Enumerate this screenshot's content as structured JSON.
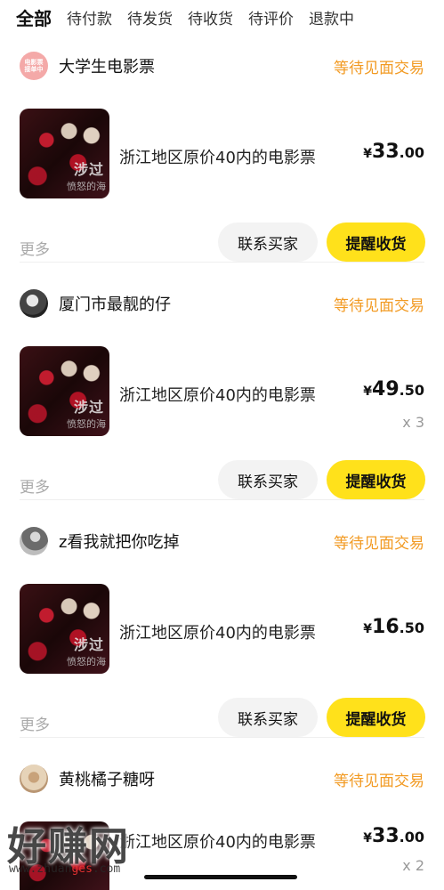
{
  "tabs": [
    "全部",
    "待付款",
    "待发货",
    "待收货",
    "待评价",
    "退款中"
  ],
  "active_tab": "全部",
  "orders": [
    {
      "seller": "大学生电影票",
      "avatar_text": "电影票\n接单中",
      "status": "等待见面交易",
      "title": "浙江地区原价40内的电影票",
      "price_currency": "¥",
      "price_int": "33",
      "price_dec": ".00",
      "qty": "",
      "more": "更多",
      "contact_label": "联系买家",
      "remind_label": "提醒收货",
      "thumb_text": "涉过",
      "thumb_text2": "愤怒的海"
    },
    {
      "seller": "厦门市最靓的仔",
      "avatar_text": "",
      "status": "等待见面交易",
      "title": "浙江地区原价40内的电影票",
      "price_currency": "¥",
      "price_int": "49",
      "price_dec": ".50",
      "qty": "x 3",
      "more": "更多",
      "contact_label": "联系买家",
      "remind_label": "提醒收货",
      "thumb_text": "涉过",
      "thumb_text2": "愤怒的海"
    },
    {
      "seller": "z看我就把你吃掉",
      "avatar_text": "",
      "status": "等待见面交易",
      "title": "浙江地区原价40内的电影票",
      "price_currency": "¥",
      "price_int": "16",
      "price_dec": ".50",
      "qty": "",
      "more": "更多",
      "contact_label": "联系买家",
      "remind_label": "提醒收货",
      "thumb_text": "涉过",
      "thumb_text2": "愤怒的海"
    },
    {
      "seller": "黄桃橘子糖呀",
      "avatar_text": "",
      "status": "等待见面交易",
      "title": "浙江地区原价40内的电影票",
      "price_currency": "¥",
      "price_int": "33",
      "price_dec": ".00",
      "qty": "x 2",
      "more": "",
      "contact_label": "",
      "remind_label": "",
      "thumb_text": "",
      "thumb_text2": ""
    }
  ],
  "watermark": {
    "big": "好赚网",
    "small_pre": "www.zhuan",
    "small_hl": "ges",
    "small_post": ".com"
  },
  "colors": {
    "accent_yellow": "#ffe11b",
    "status_orange": "#f29a22"
  }
}
